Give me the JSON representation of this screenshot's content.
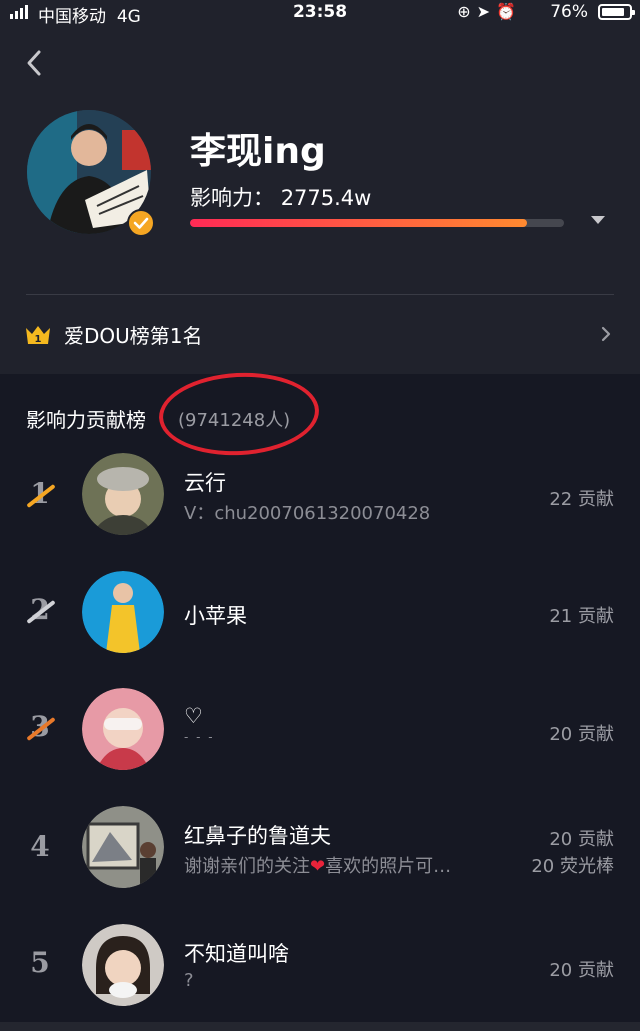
{
  "status_bar": {
    "carrier": "中国移动",
    "network": "4G",
    "time": "23:58",
    "battery": "76%"
  },
  "profile": {
    "name": "李现ing",
    "influence_label": "影响力：",
    "influence_value": "2775.4w",
    "progress_fraction": 0.9,
    "verified_color": "#f5a623"
  },
  "rank_banner": {
    "icon": "crown-icon",
    "label": "爱DOU榜第1名"
  },
  "contribution": {
    "title": "影响力贡献榜",
    "count": "(9741248人)"
  },
  "ranking": [
    {
      "rank": "1",
      "name": "云行",
      "sub": "V：chu2007061320070428",
      "score": "22 贡献",
      "score2": ""
    },
    {
      "rank": "2",
      "name": "小苹果",
      "sub": "",
      "score": "21 贡献",
      "score2": ""
    },
    {
      "rank": "3",
      "name": "♡",
      "sub": "- - -",
      "score": "20 贡献",
      "score2": ""
    },
    {
      "rank": "4",
      "name": "红鼻子的鲁道夫",
      "sub_prefix": "谢谢亲们的关注",
      "sub_suffix": "喜欢的照片可…",
      "score": "20 贡献",
      "score2": "20 荧光棒"
    },
    {
      "rank": "5",
      "name": "不知道叫啥",
      "sub": "?",
      "score": "20 贡献",
      "score2": ""
    }
  ],
  "colors": {
    "background": "#161823",
    "header": "#20222c",
    "accent_gold": "#f5a623",
    "progress_start": "#ff2a55",
    "progress_end": "#ff8a30",
    "annotation_red": "#e0222f"
  }
}
